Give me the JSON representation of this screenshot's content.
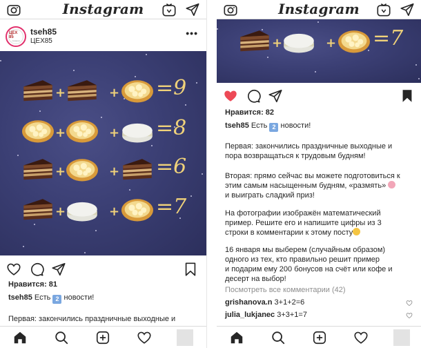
{
  "app_title": "Instagram",
  "post": {
    "username": "tseh85",
    "location": "ЦЕХ85",
    "avatar_text": "ЦЕХ 85",
    "avatar_sub": "пекарня",
    "more_label": "•••",
    "likes": "Нравится: 81",
    "caption_badge": "2",
    "caption_rest": "новости!",
    "caption_start": "Есть",
    "para1": "Первая: закончились праздничные выходные и"
  },
  "puzzle": {
    "rows": [
      {
        "items": [
          "chocolate-cake",
          "chocolate-cake",
          "cheese-tart"
        ],
        "result": "9"
      },
      {
        "items": [
          "cheese-tart",
          "cheese-tart",
          "macaron-pair"
        ],
        "result": "8"
      },
      {
        "items": [
          "chocolate-cake",
          "cheese-tart",
          "chocolate-cake"
        ],
        "result": "6"
      },
      {
        "items": [
          "chocolate-cake",
          "macaron-pair",
          "cheese-tart"
        ],
        "result": "7"
      }
    ],
    "plus": "+",
    "equals": "="
  },
  "right_post": {
    "likes": "Нравится: 82",
    "username": "tseh85",
    "caption_start": "Есть",
    "caption_badge": "2",
    "caption_rest": "новости!",
    "para1_line1": "Первая: закончились праздничные выходные и",
    "para1_line2": "пора возвращаться к трудовым будням!",
    "para2_line1": "Вторая: прямо сейчас вы можете подготовиться к",
    "para2_line2": "этим самым насыщенным будням, «размять»",
    "para2_line3": "и выиграть сладкий приз!",
    "para3_line1": "На фотографии изображён математический",
    "para3_line2": "пример. Решите его и напишите цифры из 3",
    "para3_line3": "строки в комментарии к этому посту",
    "para4_line1": "16 января мы выберем (случайным образом)",
    "para4_line2": "одного из тех, кто правильно решит пример",
    "para4_line3": "и подарим ему 200 бонусов на счёт или кофе и",
    "para4_line4": "десерт на выбор!",
    "view_all": "Посмотреть все комментарии (42)",
    "comments": [
      {
        "user": "grishanova.n",
        "text": "3+1+2=6"
      },
      {
        "user": "julia_lukjanec",
        "text": "3+3+1=7"
      }
    ]
  },
  "colors": {
    "liked_heart": "#ed4956",
    "gold": "#f0d27a",
    "image_bg": "#3b3f74",
    "badge": "#7aa7e0"
  },
  "icons": [
    "camera-icon",
    "igtv-icon",
    "direct-icon",
    "heart-icon",
    "comment-icon",
    "share-icon",
    "bookmark-icon",
    "home-icon",
    "search-icon",
    "add-icon",
    "activity-icon"
  ]
}
